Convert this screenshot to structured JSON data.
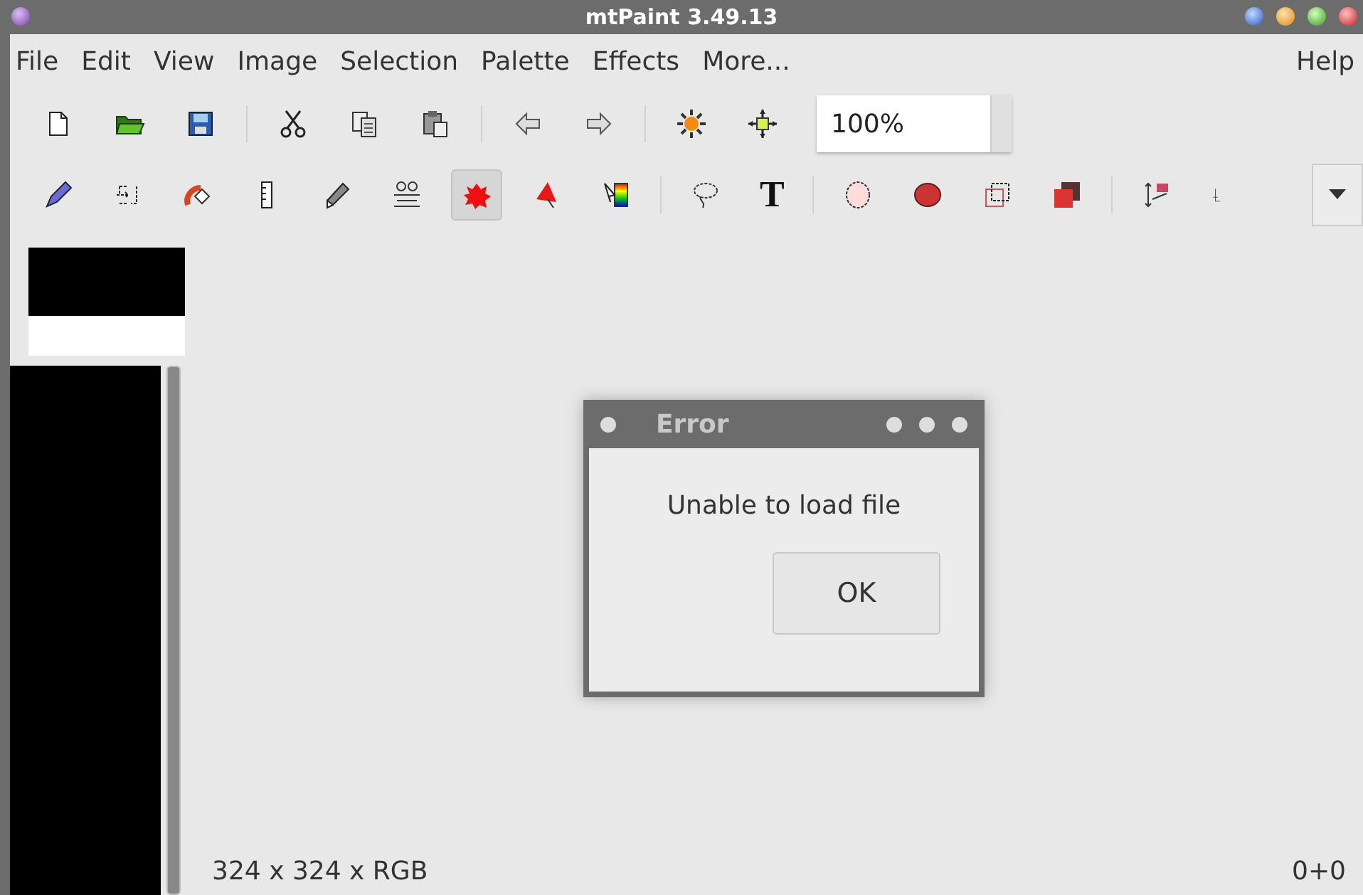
{
  "window": {
    "title": "mtPaint 3.49.13"
  },
  "menu": [
    "File",
    "Edit",
    "View",
    "Image",
    "Selection",
    "Palette",
    "Effects",
    "More...",
    "Help"
  ],
  "zoom_field": {
    "value": "100%"
  },
  "tools": [
    {
      "selected": false
    },
    {
      "selected": false
    },
    {
      "selected": false
    },
    {
      "selected": false
    },
    {
      "selected": false
    },
    {
      "selected": false
    },
    {
      "selected": true
    },
    {
      "selected": false
    },
    {
      "selected": false
    },
    {
      "selected": false
    },
    {
      "selected": false,
      "glyph": "T"
    },
    {
      "selected": false
    },
    {
      "selected": false
    },
    {
      "selected": false
    },
    {
      "selected": false
    },
    {
      "selected": false
    },
    {
      "selected": false
    }
  ],
  "status_bar": {
    "image_info": "324 x 324 x RGB",
    "coordinates": "0+0"
  },
  "dialog": {
    "title": "Error",
    "message": "Unable to load file",
    "button": "OK"
  }
}
